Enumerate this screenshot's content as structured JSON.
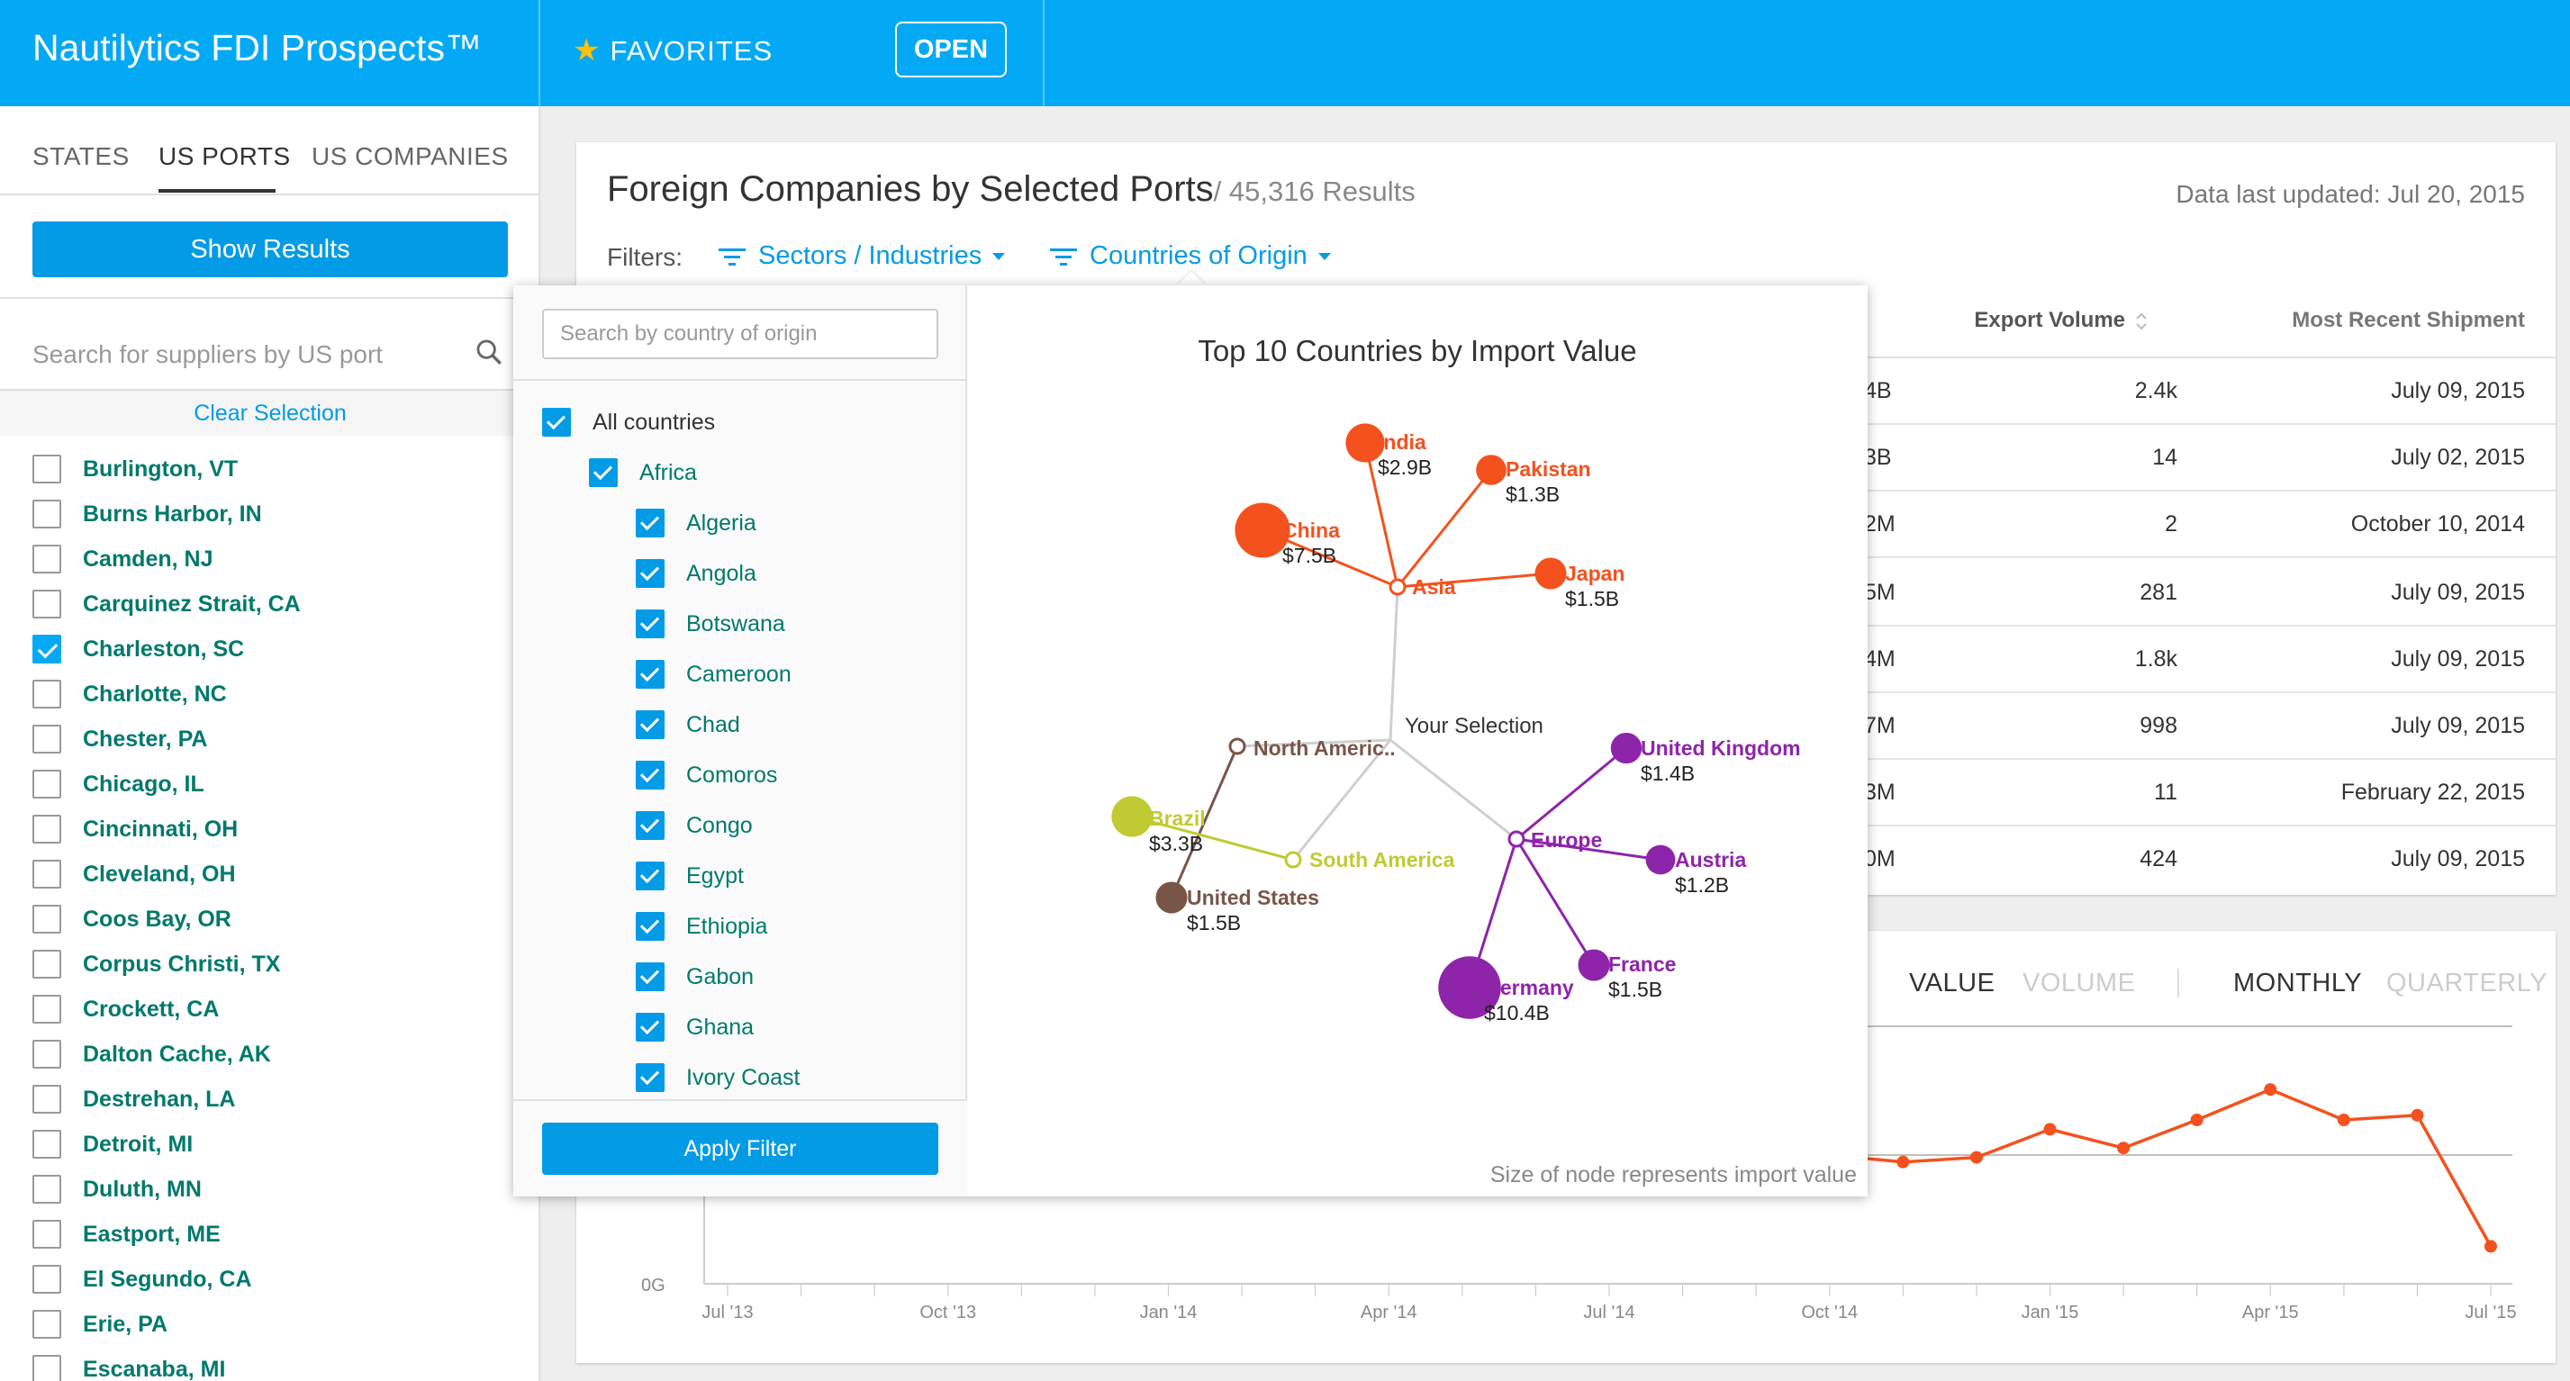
{
  "app": {
    "title": "Nautilytics FDI Prospects™",
    "favorites_label": "FAVORITES",
    "open_label": "OPEN"
  },
  "sidebar": {
    "tabs": [
      "STATES",
      "US PORTS",
      "US COMPANIES"
    ],
    "show_results": "Show Results",
    "search_placeholder": "Search for suppliers by US port",
    "clear_selection": "Clear Selection",
    "ports": [
      {
        "name": "Burlington, VT",
        "checked": false
      },
      {
        "name": "Burns Harbor, IN",
        "checked": false
      },
      {
        "name": "Camden, NJ",
        "checked": false
      },
      {
        "name": "Carquinez Strait, CA",
        "checked": false
      },
      {
        "name": "Charleston, SC",
        "checked": true
      },
      {
        "name": "Charlotte, NC",
        "checked": false
      },
      {
        "name": "Chester, PA",
        "checked": false
      },
      {
        "name": "Chicago, IL",
        "checked": false
      },
      {
        "name": "Cincinnati, OH",
        "checked": false
      },
      {
        "name": "Cleveland, OH",
        "checked": false
      },
      {
        "name": "Coos Bay, OR",
        "checked": false
      },
      {
        "name": "Corpus Christi, TX",
        "checked": false
      },
      {
        "name": "Crockett, CA",
        "checked": false
      },
      {
        "name": "Dalton Cache, AK",
        "checked": false
      },
      {
        "name": "Destrehan, LA",
        "checked": false
      },
      {
        "name": "Detroit, MI",
        "checked": false
      },
      {
        "name": "Duluth, MN",
        "checked": false
      },
      {
        "name": "Eastport, ME",
        "checked": false
      },
      {
        "name": "El Segundo, CA",
        "checked": false
      },
      {
        "name": "Erie, PA",
        "checked": false
      },
      {
        "name": "Escanaba, MI",
        "checked": false
      }
    ]
  },
  "main": {
    "title": "Foreign Companies by Selected Ports",
    "count": "/ 45,316 Results",
    "last_updated": "Data last updated: Jul 20, 2015",
    "filters_label": "Filters:",
    "filter_sectors": "Sectors / Industries",
    "filter_countries": "Countries of Origin",
    "columns": {
      "export_volume": "Export Volume",
      "most_recent": "Most Recent Shipment"
    },
    "rows": [
      [
        "4B",
        "2.4k",
        "July 09, 2015"
      ],
      [
        "3B",
        "14",
        "July 02, 2015"
      ],
      [
        "2M",
        "2",
        "October 10, 2014"
      ],
      [
        "5M",
        "281",
        "July 09, 2015"
      ],
      [
        "4M",
        "1.8k",
        "July 09, 2015"
      ],
      [
        "7M",
        "998",
        "July 09, 2015"
      ],
      [
        "3M",
        "11",
        "February 22, 2015"
      ],
      [
        "0M",
        "424",
        "July 09, 2015"
      ]
    ]
  },
  "chart_toggles": {
    "value": "VALUE",
    "volume": "VOLUME",
    "monthly": "MONTHLY",
    "quarterly": "QUARTERLY"
  },
  "chart_data": {
    "type": "line",
    "x_ticks": [
      "Jul '13",
      "Oct '13",
      "Jan '14",
      "Apr '14",
      "Jul '14",
      "Oct '14",
      "Jan '15",
      "Apr '15",
      "Jul '15"
    ],
    "y_tick_label": "0G",
    "series": [
      {
        "color": "#f4511e",
        "x": [
          "Oct '14",
          "Nov '14",
          "Dec '14",
          "Jan '15",
          "Feb '15",
          "Mar '15",
          "Apr '15",
          "May '15",
          "Jun '15",
          "Jul '15"
        ],
        "values": [
          0.55,
          0.52,
          0.54,
          0.66,
          0.58,
          0.7,
          0.83,
          0.7,
          0.72,
          0.16
        ]
      }
    ],
    "ylim": [
      0,
      1.3
    ],
    "grid": "horizontal"
  },
  "countries_filter": {
    "search_placeholder": "Search by country of origin",
    "items": [
      {
        "label": "All countries",
        "level": 0
      },
      {
        "label": "Africa",
        "level": 1
      },
      {
        "label": "Algeria",
        "level": 2
      },
      {
        "label": "Angola",
        "level": 2
      },
      {
        "label": "Botswana",
        "level": 2
      },
      {
        "label": "Cameroon",
        "level": 2
      },
      {
        "label": "Chad",
        "level": 2
      },
      {
        "label": "Comoros",
        "level": 2
      },
      {
        "label": "Congo",
        "level": 2
      },
      {
        "label": "Egypt",
        "level": 2
      },
      {
        "label": "Ethiopia",
        "level": 2
      },
      {
        "label": "Gabon",
        "level": 2
      },
      {
        "label": "Ghana",
        "level": 2
      },
      {
        "label": "Ivory Coast",
        "level": 2
      }
    ],
    "apply_label": "Apply Filter"
  },
  "network_chart": {
    "title": "Top 10 Countries by Import Value",
    "caption": "Size of node represents import value",
    "root_label": "Your Selection",
    "regions": [
      {
        "name": "Asia",
        "color": "#f4511e"
      },
      {
        "name": "North America",
        "display": "North Americ..",
        "color": "#795548"
      },
      {
        "name": "South America",
        "color": "#c0ca33"
      },
      {
        "name": "Europe",
        "color": "#8e24aa"
      }
    ],
    "countries": [
      {
        "name": "India",
        "value": "$2.9B",
        "region": "Asia",
        "amount": 2.9
      },
      {
        "name": "Pakistan",
        "value": "$1.3B",
        "region": "Asia",
        "amount": 1.3
      },
      {
        "name": "China",
        "value": "$7.5B",
        "region": "Asia",
        "amount": 7.5
      },
      {
        "name": "Japan",
        "value": "$1.5B",
        "region": "Asia",
        "amount": 1.5
      },
      {
        "name": "United States",
        "value": "$1.5B",
        "region": "North America",
        "amount": 1.5
      },
      {
        "name": "Brazil",
        "value": "$3.3B",
        "region": "South America",
        "amount": 3.3
      },
      {
        "name": "United Kingdom",
        "value": "$1.4B",
        "region": "Europe",
        "amount": 1.4
      },
      {
        "name": "Austria",
        "value": "$1.2B",
        "region": "Europe",
        "amount": 1.2
      },
      {
        "name": "France",
        "value": "$1.5B",
        "region": "Europe",
        "amount": 1.5
      },
      {
        "name": "Germany",
        "value": "$10.4B",
        "region": "Europe",
        "amount": 10.4
      }
    ]
  }
}
